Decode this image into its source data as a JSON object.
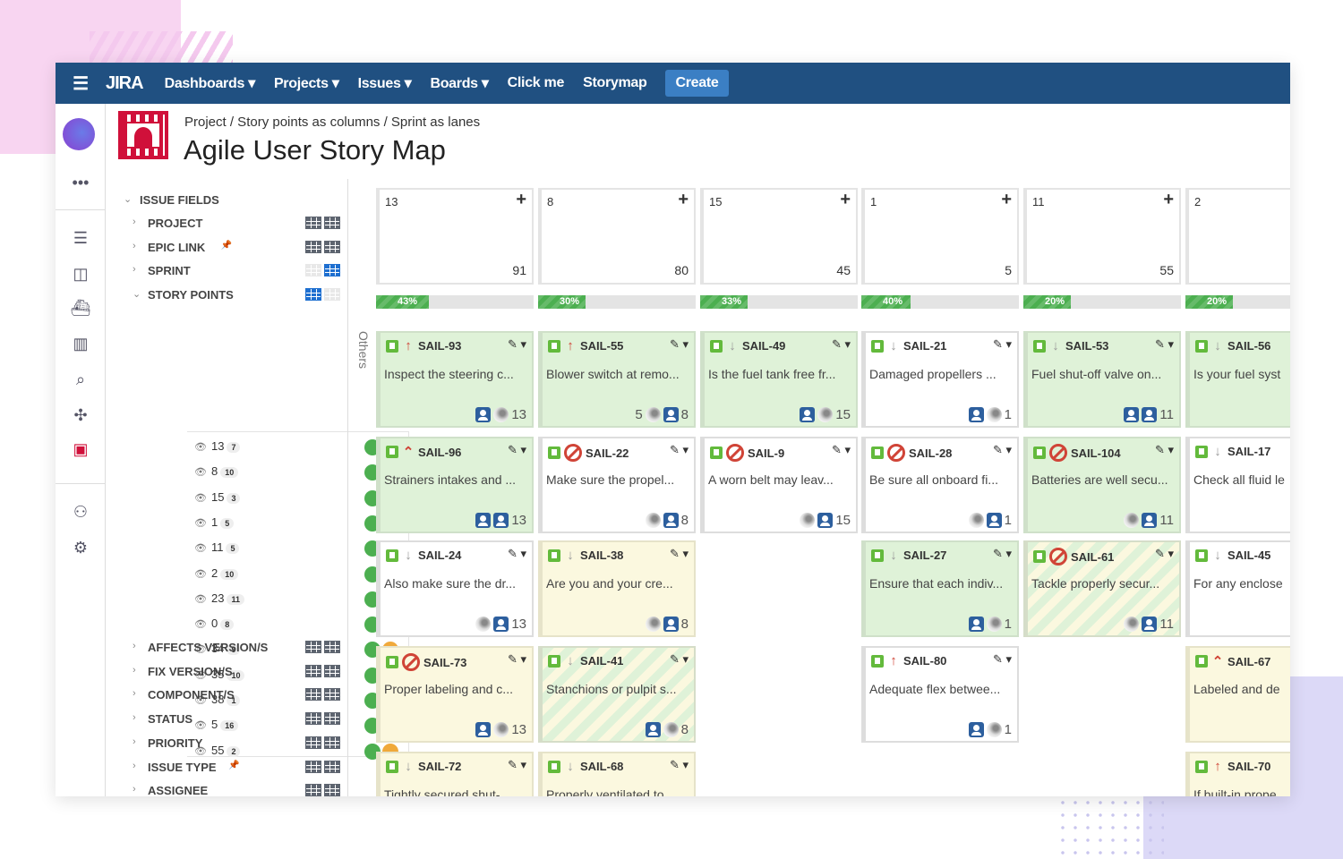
{
  "nav": {
    "logo": "JIRA",
    "items": [
      "Dashboards ▾",
      "Projects ▾",
      "Issues ▾",
      "Boards ▾",
      "Click me",
      "Storymap"
    ],
    "create": "Create"
  },
  "header": {
    "breadcrumb": "Project / Story points as columns / Sprint as lanes",
    "title": "Agile User Story Map"
  },
  "sidebar": {
    "section": "ISSUE FIELDS",
    "fields_top": [
      {
        "label": "PROJECT",
        "pinned": false,
        "expanded": false
      },
      {
        "label": "EPIC LINK",
        "pinned": true,
        "expanded": false
      },
      {
        "label": "SPRINT",
        "pinned": false,
        "expanded": false
      },
      {
        "label": "STORY POINTS",
        "pinned": false,
        "expanded": true
      }
    ],
    "story_points": [
      {
        "v": "13",
        "c": "7"
      },
      {
        "v": "8",
        "c": "10"
      },
      {
        "v": "15",
        "c": "3"
      },
      {
        "v": "1",
        "c": "5"
      },
      {
        "v": "11",
        "c": "5"
      },
      {
        "v": "2",
        "c": "10"
      },
      {
        "v": "23",
        "c": "11"
      },
      {
        "v": "0",
        "c": "8"
      },
      {
        "v": "34",
        "c": "9"
      },
      {
        "v": "35",
        "c": "10"
      },
      {
        "v": "38",
        "c": "1"
      },
      {
        "v": "5",
        "c": "16"
      },
      {
        "v": "55",
        "c": "2"
      }
    ],
    "fields_bottom": [
      {
        "label": "AFFECTS VERSION/S",
        "pinned": false
      },
      {
        "label": "FIX VERSION/S",
        "pinned": false
      },
      {
        "label": "COMPONENT/S",
        "pinned": false
      },
      {
        "label": "STATUS",
        "pinned": false
      },
      {
        "label": "PRIORITY",
        "pinned": false
      },
      {
        "label": "ISSUE TYPE",
        "pinned": true
      },
      {
        "label": "ASSIGNEE",
        "pinned": false
      }
    ]
  },
  "colors": {
    "nav": "#205081",
    "done": "#4caf50",
    "inprogress": "#f0a93b",
    "blocked": "#d04437"
  },
  "board": {
    "lane_label": "Others",
    "columns": [
      {
        "key": "13",
        "total": "91",
        "progress": "43%",
        "pct": 43
      },
      {
        "key": "8",
        "total": "80",
        "progress": "30%",
        "pct": 30
      },
      {
        "key": "15",
        "total": "45",
        "progress": "33%",
        "pct": 33
      },
      {
        "key": "1",
        "total": "5",
        "progress": "40%",
        "pct": 40
      },
      {
        "key": "11",
        "total": "55",
        "progress": "20%",
        "pct": 20
      },
      {
        "key": "2",
        "total": "",
        "progress": "20%",
        "pct": 20
      }
    ],
    "cards": [
      {
        "row": 0,
        "col": 0,
        "id": "SAIL-93",
        "priority": "up",
        "summary": "Inspect the steering c...",
        "style": "green",
        "pre": "",
        "avatars": [
          "user",
          "photo"
        ],
        "points": "13"
      },
      {
        "row": 0,
        "col": 1,
        "id": "SAIL-55",
        "priority": "up",
        "summary": "Blower switch at remo...",
        "style": "green",
        "pre": "5",
        "avatars": [
          "photo",
          "user"
        ],
        "points": "8"
      },
      {
        "row": 0,
        "col": 2,
        "id": "SAIL-49",
        "priority": "down",
        "summary": "Is the fuel tank free fr...",
        "style": "green",
        "pre": "",
        "avatars": [
          "user",
          "photo"
        ],
        "points": "15"
      },
      {
        "row": 0,
        "col": 3,
        "id": "SAIL-21",
        "priority": "down",
        "summary": "Damaged propellers ...",
        "style": "white",
        "pre": "",
        "avatars": [
          "user",
          "photo"
        ],
        "points": "1"
      },
      {
        "row": 0,
        "col": 4,
        "id": "SAIL-53",
        "priority": "down",
        "summary": "Fuel shut-off valve on...",
        "style": "green",
        "pre": "",
        "avatars": [
          "user",
          "user"
        ],
        "points": "11"
      },
      {
        "row": 0,
        "col": 5,
        "id": "SAIL-56",
        "priority": "down",
        "summary": "Is your fuel syst",
        "style": "green",
        "pre": "",
        "avatars": [],
        "points": ""
      },
      {
        "row": 1,
        "col": 0,
        "id": "SAIL-96",
        "priority": "highest",
        "summary": "Strainers intakes and ...",
        "style": "green",
        "pre": "",
        "avatars": [
          "user",
          "user"
        ],
        "points": "13"
      },
      {
        "row": 1,
        "col": 1,
        "id": "SAIL-22",
        "priority": "blocked",
        "summary": "Make sure the propel...",
        "style": "white",
        "pre": "",
        "avatars": [
          "photo",
          "user"
        ],
        "points": "8"
      },
      {
        "row": 1,
        "col": 2,
        "id": "SAIL-9",
        "priority": "blocked",
        "summary": "A worn belt may leav...",
        "style": "white",
        "pre": "",
        "avatars": [
          "photo",
          "user"
        ],
        "points": "15"
      },
      {
        "row": 1,
        "col": 3,
        "id": "SAIL-28",
        "priority": "blocked",
        "summary": "Be sure all onboard fi...",
        "style": "white",
        "pre": "",
        "avatars": [
          "photo",
          "user"
        ],
        "points": "1"
      },
      {
        "row": 1,
        "col": 4,
        "id": "SAIL-104",
        "priority": "blocked",
        "summary": "Batteries are well secu...",
        "style": "green",
        "pre": "",
        "avatars": [
          "photo",
          "user"
        ],
        "points": "11"
      },
      {
        "row": 1,
        "col": 5,
        "id": "SAIL-17",
        "priority": "down",
        "summary": "Check all fluid le",
        "style": "white",
        "pre": "",
        "avatars": [],
        "points": ""
      },
      {
        "row": 2,
        "col": 0,
        "id": "SAIL-24",
        "priority": "down",
        "summary": "Also make sure the dr...",
        "style": "white",
        "pre": "",
        "avatars": [
          "photo",
          "user"
        ],
        "points": "13"
      },
      {
        "row": 2,
        "col": 1,
        "id": "SAIL-38",
        "priority": "down",
        "summary": "Are you and your cre...",
        "style": "yellow",
        "pre": "",
        "avatars": [
          "photo",
          "user"
        ],
        "points": "8"
      },
      {
        "row": 2,
        "col": 3,
        "id": "SAIL-27",
        "priority": "down",
        "summary": "Ensure that each indiv...",
        "style": "green",
        "pre": "",
        "avatars": [
          "user",
          "photo"
        ],
        "points": "1"
      },
      {
        "row": 2,
        "col": 4,
        "id": "SAIL-61",
        "priority": "blocked",
        "summary": "Tackle properly secur...",
        "style": "stripe",
        "pre": "",
        "avatars": [
          "photo",
          "user"
        ],
        "points": "11"
      },
      {
        "row": 2,
        "col": 5,
        "id": "SAIL-45",
        "priority": "down",
        "summary": "For any enclose",
        "style": "white",
        "pre": "",
        "avatars": [],
        "points": ""
      },
      {
        "row": 3,
        "col": 0,
        "id": "SAIL-73",
        "priority": "blocked",
        "summary": "Proper labeling and c...",
        "style": "yellow",
        "pre": "",
        "avatars": [
          "user",
          "photo"
        ],
        "points": "13"
      },
      {
        "row": 3,
        "col": 1,
        "id": "SAIL-41",
        "priority": "down",
        "summary": "Stanchions or pulpit s...",
        "style": "stripe",
        "pre": "",
        "avatars": [
          "user",
          "photo"
        ],
        "points": "8"
      },
      {
        "row": 3,
        "col": 3,
        "id": "SAIL-80",
        "priority": "up",
        "summary": "Adequate flex betwee...",
        "style": "white",
        "pre": "",
        "avatars": [
          "user",
          "photo"
        ],
        "points": "1"
      },
      {
        "row": 3,
        "col": 5,
        "id": "SAIL-67",
        "priority": "highest",
        "summary": "Labeled and de",
        "style": "yellow",
        "pre": "",
        "avatars": [],
        "points": ""
      },
      {
        "row": 4,
        "col": 0,
        "id": "SAIL-72",
        "priority": "down",
        "summary": "Tightly secured shut-...",
        "style": "yellow",
        "pre": "",
        "avatars": [],
        "points": ""
      },
      {
        "row": 4,
        "col": 1,
        "id": "SAIL-68",
        "priority": "down",
        "summary": "Properly ventilated to...",
        "style": "yellow",
        "pre": "",
        "avatars": [],
        "points": ""
      },
      {
        "row": 4,
        "col": 5,
        "id": "SAIL-70",
        "priority": "up",
        "summary": "If built-in prope",
        "style": "yellow",
        "pre": "",
        "avatars": [],
        "points": ""
      }
    ]
  }
}
